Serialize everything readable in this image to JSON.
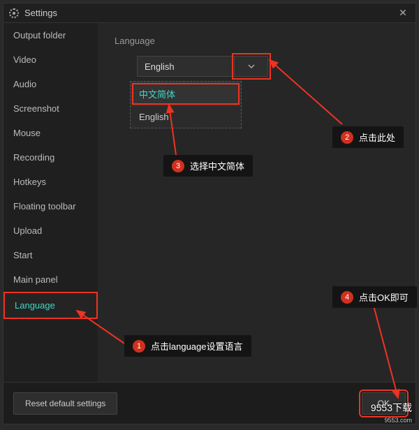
{
  "window": {
    "title": "Settings",
    "close_glyph": "✕"
  },
  "sidebar": {
    "items": [
      {
        "label": "Output folder",
        "active": false
      },
      {
        "label": "Video",
        "active": false
      },
      {
        "label": "Audio",
        "active": false
      },
      {
        "label": "Screenshot",
        "active": false
      },
      {
        "label": "Mouse",
        "active": false
      },
      {
        "label": "Recording",
        "active": false
      },
      {
        "label": "Hotkeys",
        "active": false
      },
      {
        "label": "Floating toolbar",
        "active": false
      },
      {
        "label": "Upload",
        "active": false
      },
      {
        "label": "Start",
        "active": false
      },
      {
        "label": "Main panel",
        "active": false
      },
      {
        "label": "Language",
        "active": true
      }
    ]
  },
  "content": {
    "field_label": "Language",
    "selected_value": "English",
    "dropdown_options": [
      {
        "label": "中文简体",
        "selected": true
      },
      {
        "label": "English",
        "selected": false
      }
    ]
  },
  "footer": {
    "reset_label": "Reset default settings",
    "ok_label": "OK"
  },
  "annotations": {
    "c1": {
      "num": "1",
      "text": "点击language设置语言"
    },
    "c2": {
      "num": "2",
      "text": "点击此处"
    },
    "c3": {
      "num": "3",
      "text": "选择中文简体"
    },
    "c4": {
      "num": "4",
      "text": "点击OK即可"
    }
  },
  "watermark": {
    "line1": "9553下载",
    "line2": "9553.com"
  }
}
